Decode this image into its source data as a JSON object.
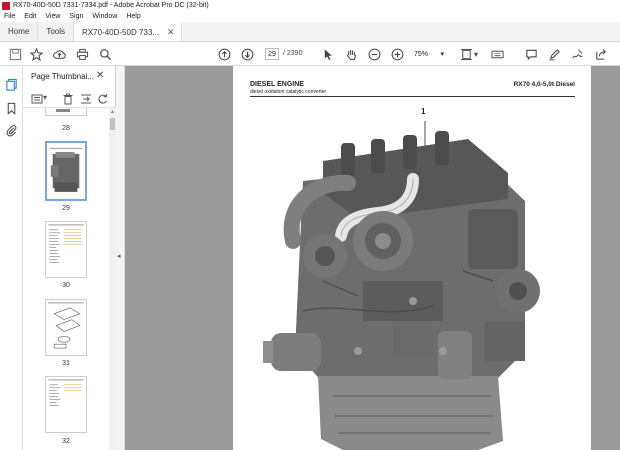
{
  "window": {
    "title": "RX70-40D-50D 7331-7334.pdf - Adobe Acrobat Pro DC (32-bit)"
  },
  "menu": [
    "File",
    "Edit",
    "View",
    "Sign",
    "Window",
    "Help"
  ],
  "tabs": {
    "home": "Home",
    "tools": "Tools",
    "document": "RX70-40D-50D 733..."
  },
  "toolbar": {
    "page_current": "29",
    "page_total": "/ 2390",
    "zoom": "75%"
  },
  "panel": {
    "title": "Page Thumbnai...",
    "thumbnails": [
      {
        "label": "28",
        "selected": false
      },
      {
        "label": "29",
        "selected": true
      },
      {
        "label": "30",
        "selected": false
      },
      {
        "label": "31",
        "selected": false
      },
      {
        "label": "32",
        "selected": false
      }
    ]
  },
  "document": {
    "heading": "DIESEL ENGINE",
    "subheading": "diesel oxidation catalytic converter",
    "model": "RX70 4,0-5,0t Diesel",
    "callout": "1"
  },
  "colors": {
    "accent": "#1473e6",
    "viewer_bg": "#9b9b9b",
    "app_red": "#c8102e"
  }
}
